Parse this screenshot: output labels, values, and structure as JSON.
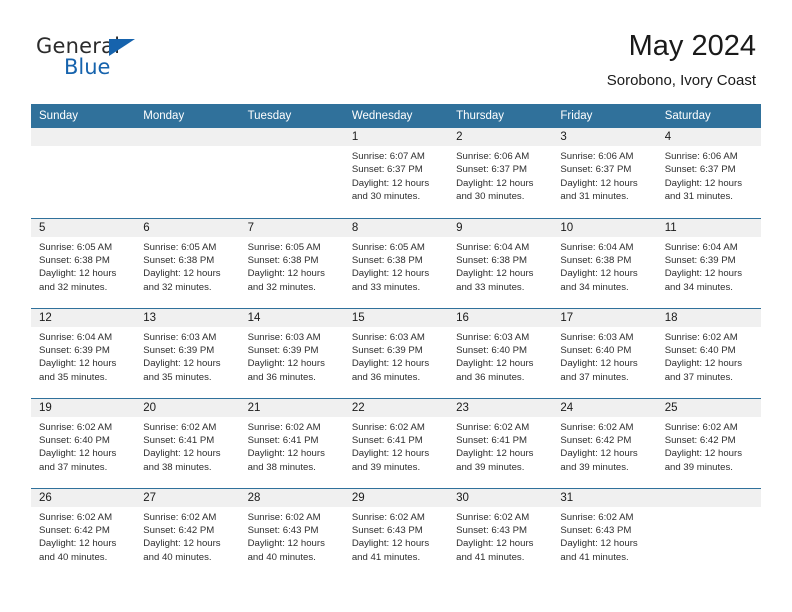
{
  "brand": {
    "name_part1": "General",
    "name_part2": "Blue",
    "logo_icon": "triangle-logo-icon"
  },
  "header": {
    "title": "May 2024",
    "subtitle": "Sorobono, Ivory Coast"
  },
  "colors": {
    "header_blue": "#30719b",
    "brand_blue": "#1663ad",
    "daynum_band": "#f0f0f0",
    "text": "#1a1a1a"
  },
  "calendar": {
    "weekday_headers": [
      "Sunday",
      "Monday",
      "Tuesday",
      "Wednesday",
      "Thursday",
      "Friday",
      "Saturday"
    ],
    "weeks": [
      [
        {
          "day": "",
          "empty": true,
          "sunrise": "",
          "sunset": "",
          "daylight_line1": "",
          "daylight_line2": ""
        },
        {
          "day": "",
          "empty": true,
          "sunrise": "",
          "sunset": "",
          "daylight_line1": "",
          "daylight_line2": ""
        },
        {
          "day": "",
          "empty": true,
          "sunrise": "",
          "sunset": "",
          "daylight_line1": "",
          "daylight_line2": ""
        },
        {
          "day": "1",
          "empty": false,
          "sunrise": "Sunrise: 6:07 AM",
          "sunset": "Sunset: 6:37 PM",
          "daylight_line1": "Daylight: 12 hours",
          "daylight_line2": "and 30 minutes."
        },
        {
          "day": "2",
          "empty": false,
          "sunrise": "Sunrise: 6:06 AM",
          "sunset": "Sunset: 6:37 PM",
          "daylight_line1": "Daylight: 12 hours",
          "daylight_line2": "and 30 minutes."
        },
        {
          "day": "3",
          "empty": false,
          "sunrise": "Sunrise: 6:06 AM",
          "sunset": "Sunset: 6:37 PM",
          "daylight_line1": "Daylight: 12 hours",
          "daylight_line2": "and 31 minutes."
        },
        {
          "day": "4",
          "empty": false,
          "sunrise": "Sunrise: 6:06 AM",
          "sunset": "Sunset: 6:37 PM",
          "daylight_line1": "Daylight: 12 hours",
          "daylight_line2": "and 31 minutes."
        }
      ],
      [
        {
          "day": "5",
          "empty": false,
          "sunrise": "Sunrise: 6:05 AM",
          "sunset": "Sunset: 6:38 PM",
          "daylight_line1": "Daylight: 12 hours",
          "daylight_line2": "and 32 minutes."
        },
        {
          "day": "6",
          "empty": false,
          "sunrise": "Sunrise: 6:05 AM",
          "sunset": "Sunset: 6:38 PM",
          "daylight_line1": "Daylight: 12 hours",
          "daylight_line2": "and 32 minutes."
        },
        {
          "day": "7",
          "empty": false,
          "sunrise": "Sunrise: 6:05 AM",
          "sunset": "Sunset: 6:38 PM",
          "daylight_line1": "Daylight: 12 hours",
          "daylight_line2": "and 32 minutes."
        },
        {
          "day": "8",
          "empty": false,
          "sunrise": "Sunrise: 6:05 AM",
          "sunset": "Sunset: 6:38 PM",
          "daylight_line1": "Daylight: 12 hours",
          "daylight_line2": "and 33 minutes."
        },
        {
          "day": "9",
          "empty": false,
          "sunrise": "Sunrise: 6:04 AM",
          "sunset": "Sunset: 6:38 PM",
          "daylight_line1": "Daylight: 12 hours",
          "daylight_line2": "and 33 minutes."
        },
        {
          "day": "10",
          "empty": false,
          "sunrise": "Sunrise: 6:04 AM",
          "sunset": "Sunset: 6:38 PM",
          "daylight_line1": "Daylight: 12 hours",
          "daylight_line2": "and 34 minutes."
        },
        {
          "day": "11",
          "empty": false,
          "sunrise": "Sunrise: 6:04 AM",
          "sunset": "Sunset: 6:39 PM",
          "daylight_line1": "Daylight: 12 hours",
          "daylight_line2": "and 34 minutes."
        }
      ],
      [
        {
          "day": "12",
          "empty": false,
          "sunrise": "Sunrise: 6:04 AM",
          "sunset": "Sunset: 6:39 PM",
          "daylight_line1": "Daylight: 12 hours",
          "daylight_line2": "and 35 minutes."
        },
        {
          "day": "13",
          "empty": false,
          "sunrise": "Sunrise: 6:03 AM",
          "sunset": "Sunset: 6:39 PM",
          "daylight_line1": "Daylight: 12 hours",
          "daylight_line2": "and 35 minutes."
        },
        {
          "day": "14",
          "empty": false,
          "sunrise": "Sunrise: 6:03 AM",
          "sunset": "Sunset: 6:39 PM",
          "daylight_line1": "Daylight: 12 hours",
          "daylight_line2": "and 36 minutes."
        },
        {
          "day": "15",
          "empty": false,
          "sunrise": "Sunrise: 6:03 AM",
          "sunset": "Sunset: 6:39 PM",
          "daylight_line1": "Daylight: 12 hours",
          "daylight_line2": "and 36 minutes."
        },
        {
          "day": "16",
          "empty": false,
          "sunrise": "Sunrise: 6:03 AM",
          "sunset": "Sunset: 6:40 PM",
          "daylight_line1": "Daylight: 12 hours",
          "daylight_line2": "and 36 minutes."
        },
        {
          "day": "17",
          "empty": false,
          "sunrise": "Sunrise: 6:03 AM",
          "sunset": "Sunset: 6:40 PM",
          "daylight_line1": "Daylight: 12 hours",
          "daylight_line2": "and 37 minutes."
        },
        {
          "day": "18",
          "empty": false,
          "sunrise": "Sunrise: 6:02 AM",
          "sunset": "Sunset: 6:40 PM",
          "daylight_line1": "Daylight: 12 hours",
          "daylight_line2": "and 37 minutes."
        }
      ],
      [
        {
          "day": "19",
          "empty": false,
          "sunrise": "Sunrise: 6:02 AM",
          "sunset": "Sunset: 6:40 PM",
          "daylight_line1": "Daylight: 12 hours",
          "daylight_line2": "and 37 minutes."
        },
        {
          "day": "20",
          "empty": false,
          "sunrise": "Sunrise: 6:02 AM",
          "sunset": "Sunset: 6:41 PM",
          "daylight_line1": "Daylight: 12 hours",
          "daylight_line2": "and 38 minutes."
        },
        {
          "day": "21",
          "empty": false,
          "sunrise": "Sunrise: 6:02 AM",
          "sunset": "Sunset: 6:41 PM",
          "daylight_line1": "Daylight: 12 hours",
          "daylight_line2": "and 38 minutes."
        },
        {
          "day": "22",
          "empty": false,
          "sunrise": "Sunrise: 6:02 AM",
          "sunset": "Sunset: 6:41 PM",
          "daylight_line1": "Daylight: 12 hours",
          "daylight_line2": "and 39 minutes."
        },
        {
          "day": "23",
          "empty": false,
          "sunrise": "Sunrise: 6:02 AM",
          "sunset": "Sunset: 6:41 PM",
          "daylight_line1": "Daylight: 12 hours",
          "daylight_line2": "and 39 minutes."
        },
        {
          "day": "24",
          "empty": false,
          "sunrise": "Sunrise: 6:02 AM",
          "sunset": "Sunset: 6:42 PM",
          "daylight_line1": "Daylight: 12 hours",
          "daylight_line2": "and 39 minutes."
        },
        {
          "day": "25",
          "empty": false,
          "sunrise": "Sunrise: 6:02 AM",
          "sunset": "Sunset: 6:42 PM",
          "daylight_line1": "Daylight: 12 hours",
          "daylight_line2": "and 39 minutes."
        }
      ],
      [
        {
          "day": "26",
          "empty": false,
          "sunrise": "Sunrise: 6:02 AM",
          "sunset": "Sunset: 6:42 PM",
          "daylight_line1": "Daylight: 12 hours",
          "daylight_line2": "and 40 minutes."
        },
        {
          "day": "27",
          "empty": false,
          "sunrise": "Sunrise: 6:02 AM",
          "sunset": "Sunset: 6:42 PM",
          "daylight_line1": "Daylight: 12 hours",
          "daylight_line2": "and 40 minutes."
        },
        {
          "day": "28",
          "empty": false,
          "sunrise": "Sunrise: 6:02 AM",
          "sunset": "Sunset: 6:43 PM",
          "daylight_line1": "Daylight: 12 hours",
          "daylight_line2": "and 40 minutes."
        },
        {
          "day": "29",
          "empty": false,
          "sunrise": "Sunrise: 6:02 AM",
          "sunset": "Sunset: 6:43 PM",
          "daylight_line1": "Daylight: 12 hours",
          "daylight_line2": "and 41 minutes."
        },
        {
          "day": "30",
          "empty": false,
          "sunrise": "Sunrise: 6:02 AM",
          "sunset": "Sunset: 6:43 PM",
          "daylight_line1": "Daylight: 12 hours",
          "daylight_line2": "and 41 minutes."
        },
        {
          "day": "31",
          "empty": false,
          "sunrise": "Sunrise: 6:02 AM",
          "sunset": "Sunset: 6:43 PM",
          "daylight_line1": "Daylight: 12 hours",
          "daylight_line2": "and 41 minutes."
        },
        {
          "day": "",
          "empty": true,
          "sunrise": "",
          "sunset": "",
          "daylight_line1": "",
          "daylight_line2": ""
        }
      ]
    ]
  }
}
